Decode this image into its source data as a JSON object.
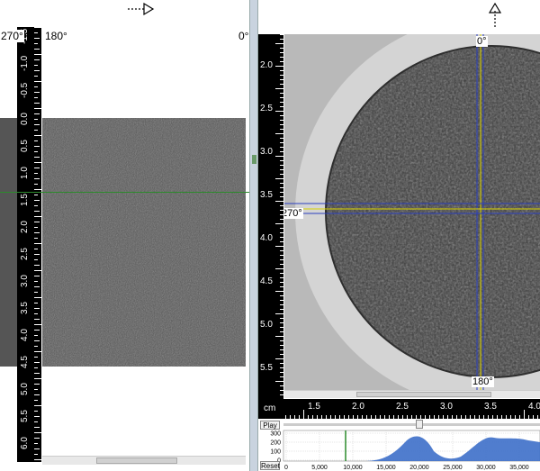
{
  "left_view": {
    "angle_labels": {
      "left": "270°",
      "start": "180°",
      "end": "0°"
    },
    "ruler_labels": [
      "-1.5",
      "-1.0",
      "-0.5",
      "0.0",
      "0.5",
      "1.0",
      "1.5",
      "2.0",
      "2.5",
      "3.0",
      "3.5",
      "4.0",
      "4.5",
      "5.0",
      "5.5",
      "6.0"
    ]
  },
  "right_view": {
    "angle_labels": {
      "top": "0°",
      "left": "270°",
      "bottom": "180°"
    },
    "ruler_labels": [
      "2.0",
      "2.5",
      "3.0",
      "3.5",
      "4.0",
      "4.5",
      "5.0",
      "5.5"
    ],
    "bottom_ruler": {
      "unit": "cm",
      "labels": [
        "1.5",
        "2.0",
        "2.5",
        "3.0",
        "3.5",
        "4.0"
      ]
    }
  },
  "histogram": {
    "play_label": "Play",
    "reset_label": "Reset",
    "y_labels": [
      "300",
      "200",
      "100",
      "0"
    ],
    "x_labels": [
      "0",
      "5,000",
      "10,000",
      "15,000",
      "20,000",
      "25,000",
      "30,000",
      "35,000"
    ],
    "colors": {
      "fill": "#3d6fc9",
      "marker": "#2b8a2b"
    }
  }
}
